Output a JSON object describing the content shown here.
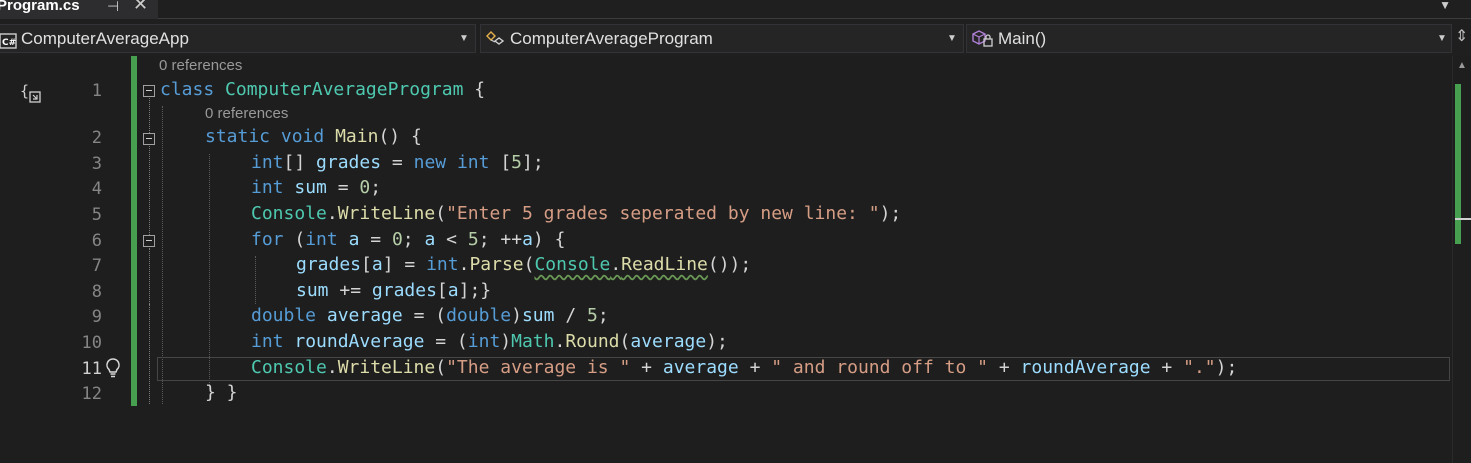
{
  "tab": {
    "title": "Program.cs",
    "pin": "⊣",
    "close": "✕"
  },
  "navbar": {
    "project": "ComputerAverageApp",
    "project_icon": "C#",
    "class": "ComputerAverageProgram",
    "member": "Main()"
  },
  "editor": {
    "references_label": "0 references",
    "active_line": 11,
    "lines": [
      {
        "n": "1"
      },
      {
        "n": "2"
      },
      {
        "n": "3"
      },
      {
        "n": "4"
      },
      {
        "n": "5"
      },
      {
        "n": "6"
      },
      {
        "n": "7"
      },
      {
        "n": "8"
      },
      {
        "n": "9"
      },
      {
        "n": "10"
      },
      {
        "n": "11"
      },
      {
        "n": "12"
      }
    ],
    "code": {
      "l1": [
        "class",
        "ComputerAverageProgram",
        "{"
      ],
      "l2": [
        "static",
        "void",
        "Main",
        "()",
        "{"
      ],
      "l3": [
        "int",
        "[]",
        "grades",
        "=",
        "new",
        "int",
        "[",
        "5",
        "];"
      ],
      "l4": [
        "int",
        "sum",
        "=",
        "0",
        ";"
      ],
      "l5": [
        "Console",
        ".",
        "WriteLine",
        "(",
        "\"Enter 5 grades seperated by new line: \"",
        ");"
      ],
      "l6": [
        "for",
        "(",
        "int",
        "a",
        "=",
        "0",
        ";",
        "a",
        "<",
        "5",
        ";",
        "++",
        "a",
        ") {"
      ],
      "l7": [
        "grades",
        "[",
        "a",
        "] = ",
        "int",
        ".",
        "Parse",
        "(",
        "Console",
        ".",
        "ReadLine",
        "());"
      ],
      "l8": [
        "sum",
        "+=",
        "grades",
        "[",
        "a",
        "];}"
      ],
      "l9": [
        "double",
        "average",
        "= (",
        "double",
        ")",
        "sum",
        "/",
        "5",
        ";"
      ],
      "l10": [
        "int",
        "roundAverage",
        "= (",
        "int",
        ")",
        "Math",
        ".",
        "Round",
        "(",
        "average",
        ");"
      ],
      "l11": [
        "Console",
        ".",
        "WriteLine",
        "(",
        "\"The average is \"",
        "+",
        "average",
        "+",
        "\" and round off to \"",
        "+",
        "roundAverage",
        "+",
        "\".\"",
        ");"
      ],
      "l12": [
        "} }"
      ]
    }
  },
  "colors": {
    "keyword": "#569cd6",
    "type": "#4ec9b0",
    "method": "#dcdcaa",
    "string": "#d69d85",
    "number": "#b5cea8",
    "variable": "#9cdcfe",
    "change_bar": "#46a04f"
  },
  "icons": [
    "pin-icon",
    "close-icon",
    "csharp-project-icon",
    "class-icon",
    "method-icon",
    "dropdown-arrow-icon",
    "lightbulb-icon",
    "namespace-scope-icon",
    "split-editor-icon"
  ]
}
